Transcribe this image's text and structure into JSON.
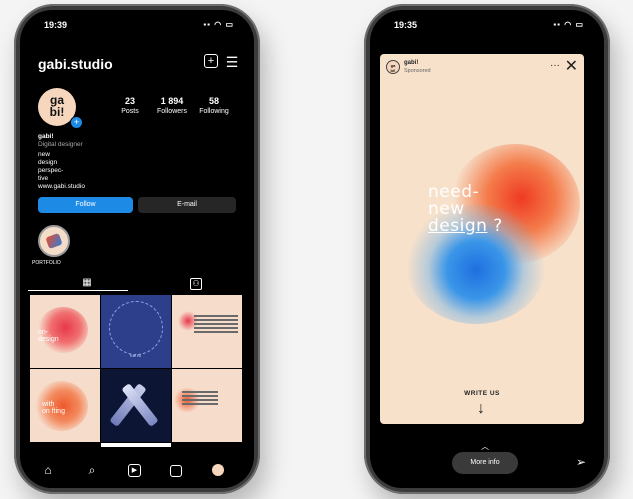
{
  "left_phone": {
    "status_time": "19:39",
    "username": "gabi.studio",
    "header_icons": [
      "add-icon",
      "menu-icon"
    ],
    "avatar_text": "ga\nbi!",
    "stats": [
      {
        "value": "23",
        "label": "Posts"
      },
      {
        "value": "1 894",
        "label": "Followers"
      },
      {
        "value": "58",
        "label": "Following"
      }
    ],
    "bio": {
      "name": "gabi!",
      "role": "Digital designer",
      "lines": [
        "new",
        "design",
        "perspec-",
        "tive"
      ],
      "link": "www.gabi.studio"
    },
    "buttons": {
      "follow": "Follow",
      "email": "E-mail"
    },
    "highlight_label": "PORTFOLIO",
    "grid": {
      "cell1": "on-\ndesign",
      "cell4": "with\non fting",
      "cell2_caption": "Træ Bl"
    },
    "nav_icons": [
      "home-icon",
      "search-icon",
      "reels-icon",
      "shop-icon",
      "profile-icon"
    ]
  },
  "right_phone": {
    "status_time": "19:35",
    "ad_name": "gabi!",
    "ad_sponsored": "Sponsored",
    "headline": {
      "line1": "need-",
      "line2": "new",
      "line3": "design",
      "line3_suffix": " ?"
    },
    "cta": "WRITE US",
    "more_info": "More info"
  },
  "colors": {
    "brand_blue": "#1d8ae6",
    "peach": "#f7e1cb",
    "orange": "#ef4a2c",
    "blue": "#2a7fd9"
  }
}
